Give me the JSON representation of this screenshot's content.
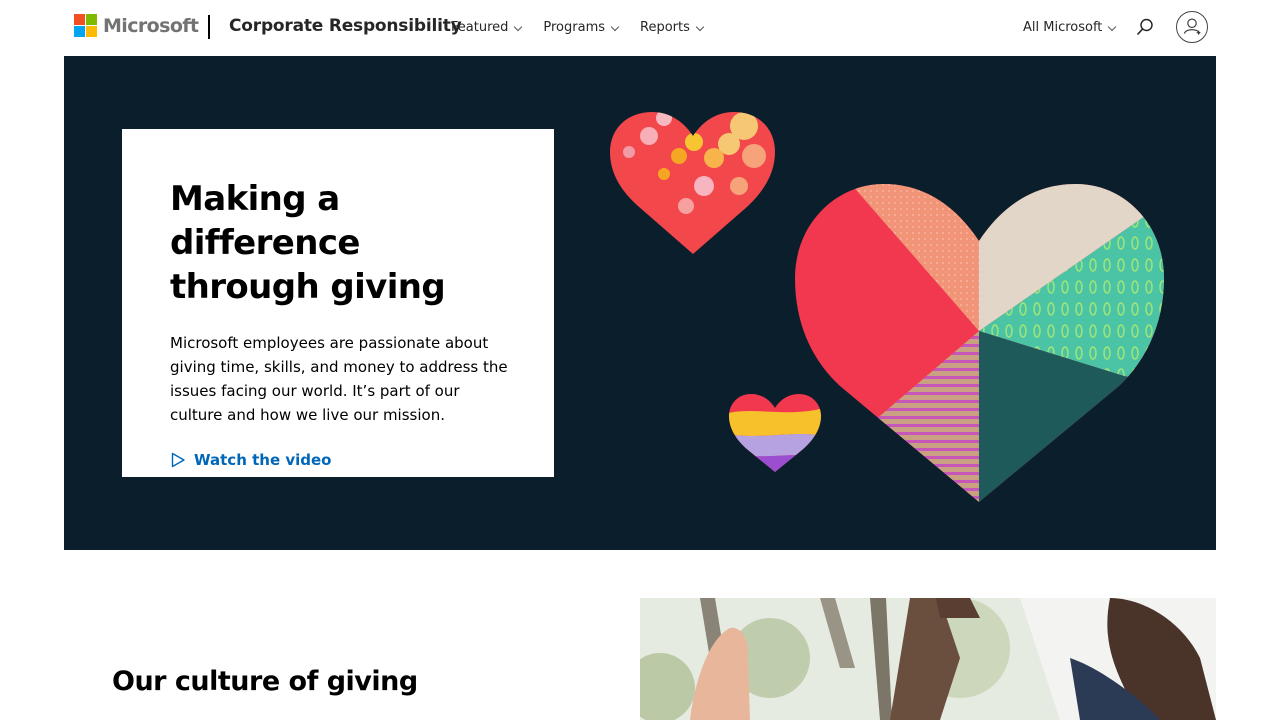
{
  "header": {
    "brand": "Microsoft",
    "site_title": "Corporate Responsibility",
    "nav": [
      {
        "label": "Featured"
      },
      {
        "label": "Programs"
      },
      {
        "label": "Reports"
      }
    ],
    "all_microsoft": "All Microsoft"
  },
  "hero": {
    "title": "Making a difference through giving",
    "body": "Microsoft employees are passionate about giving time, skills, and money to address the issues facing our world. It’s part of our culture and how we live our mission.",
    "cta": "Watch the video",
    "background_color": "#0a1e2b"
  },
  "culture": {
    "title": "Our culture of giving"
  },
  "colors": {
    "link": "#0067b8",
    "logo_red": "#f25022",
    "logo_green": "#7fba00",
    "logo_blue": "#00a4ef",
    "logo_yellow": "#ffb900"
  },
  "icons": [
    "microsoft-logo-icon",
    "chevron-down-icon",
    "search-icon",
    "account-icon",
    "play-icon"
  ]
}
